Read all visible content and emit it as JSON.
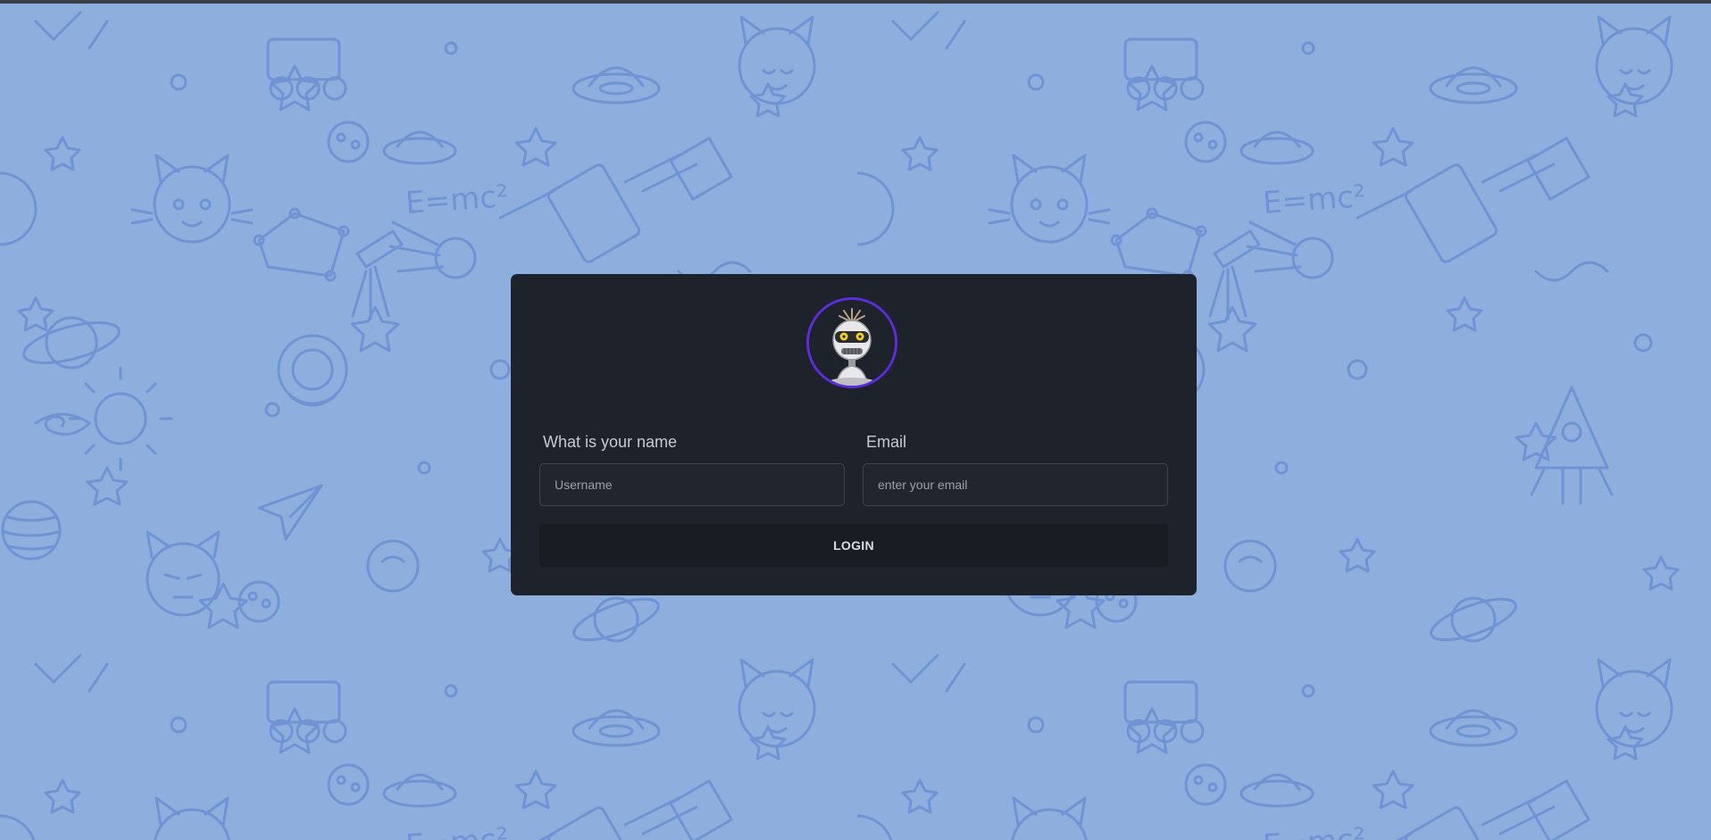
{
  "theme": {
    "background": "#8eaedd",
    "doodle_stroke": "#6f93d3",
    "card": "#1e222b",
    "avatar_ring": "#5b2ddb",
    "button": "#191c23"
  },
  "background": {
    "doodle_text": "E=mc²"
  },
  "login": {
    "avatar_icon": "robot-mascot-icon",
    "name_label": "What is your name",
    "name_placeholder": "Username",
    "name_value": "",
    "email_label": "Email",
    "email_placeholder": "enter your email",
    "email_value": "",
    "button_label": "LOGIN"
  }
}
